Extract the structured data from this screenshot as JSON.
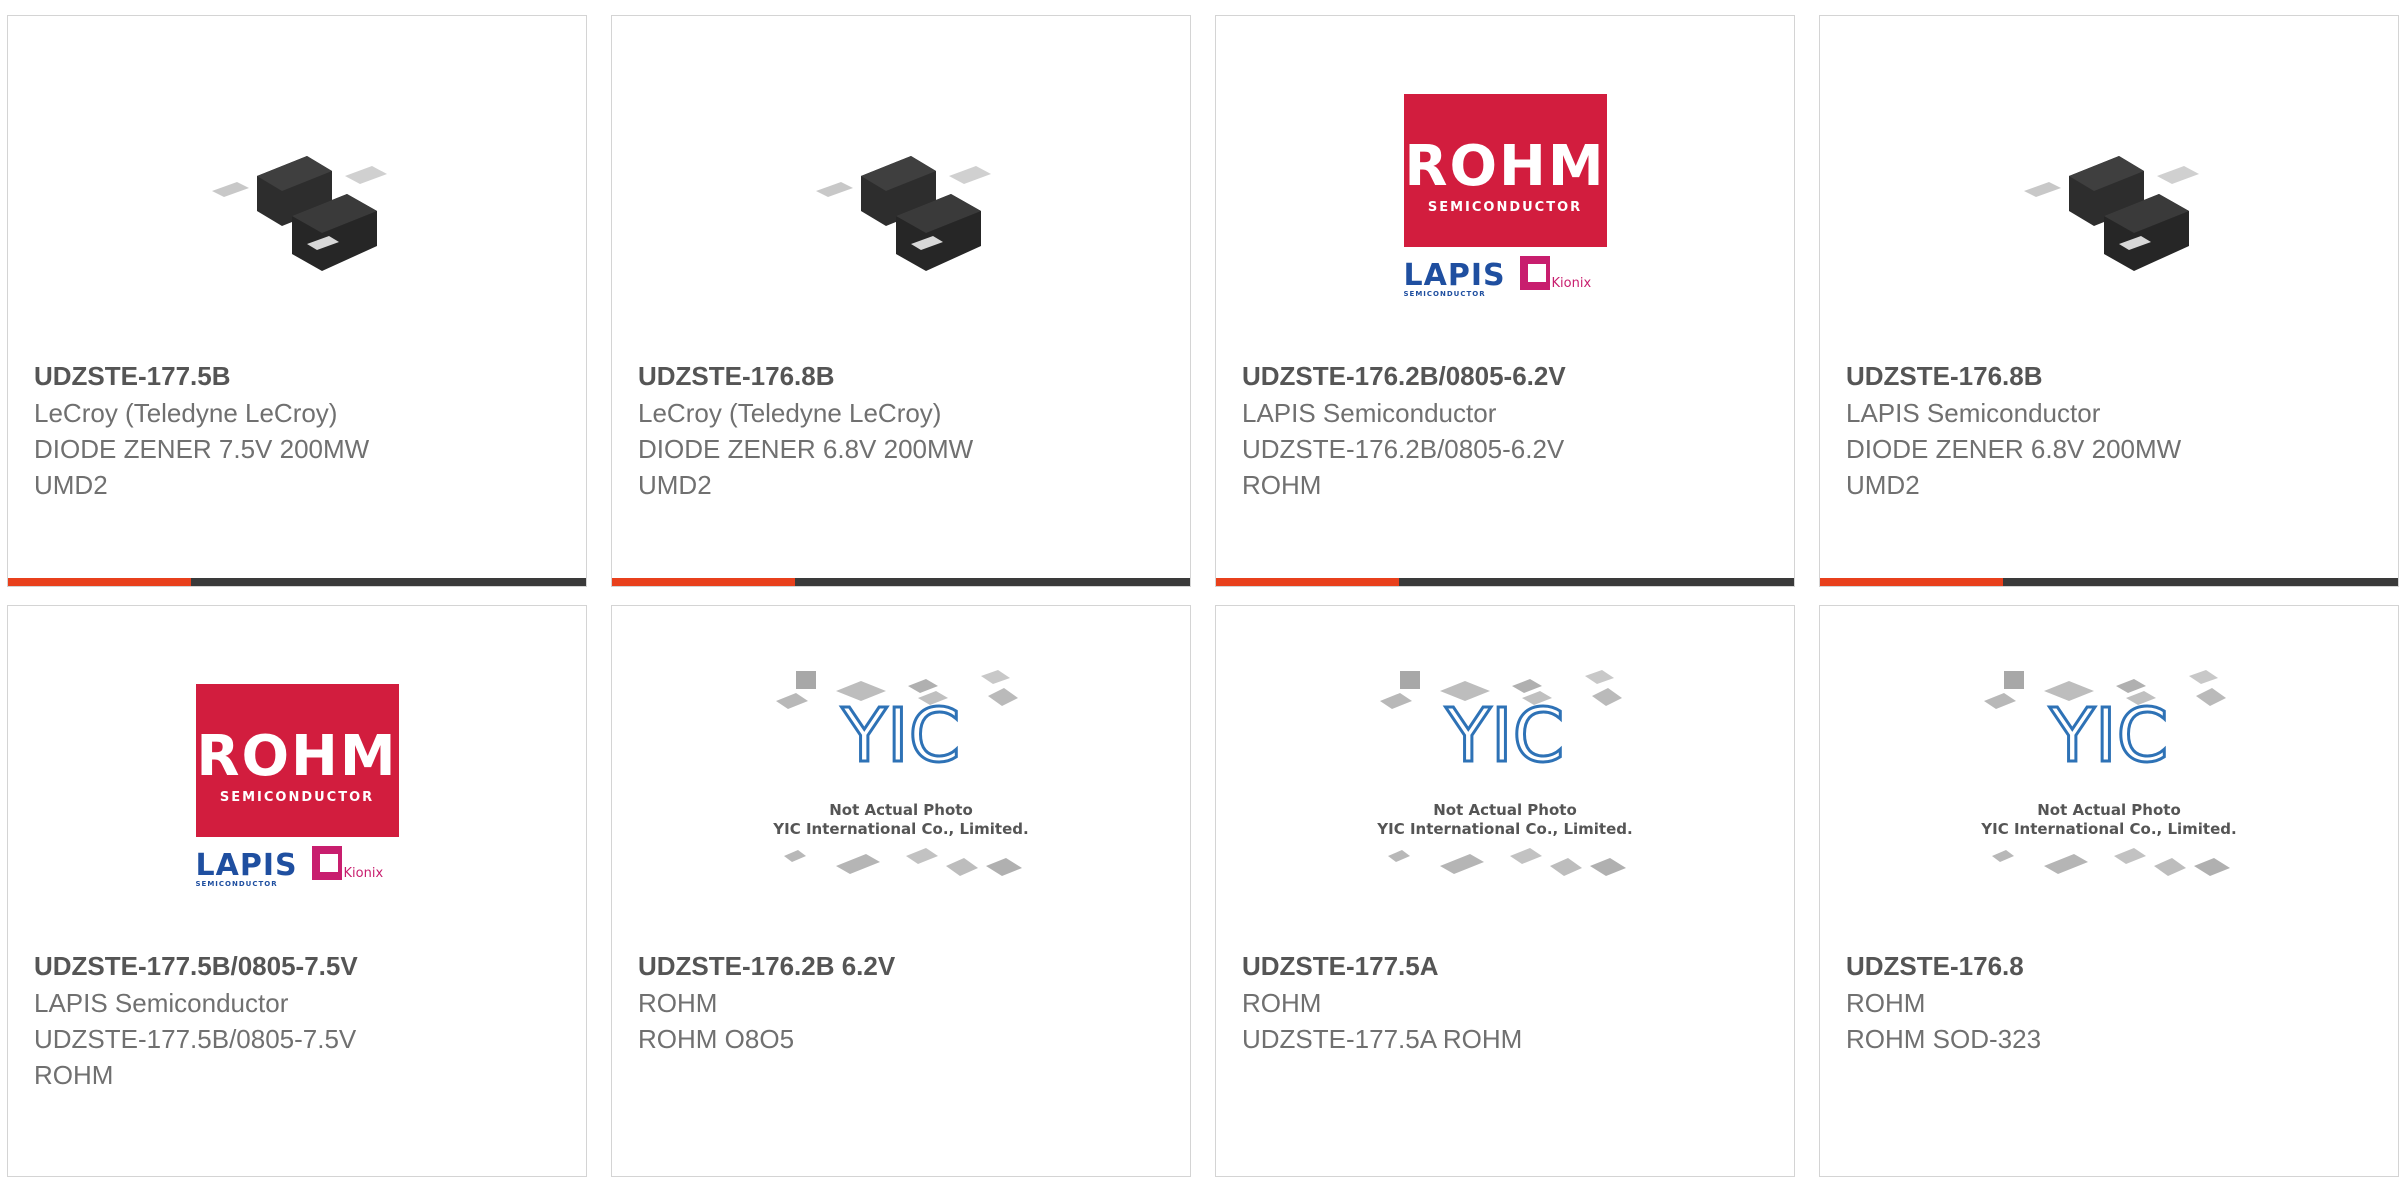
{
  "cards": [
    {
      "title": "UDZSTE-177.5B",
      "maker": "LeCroy (Teledyne LeCroy)",
      "desc": "DIODE ZENER 7.5V 200MW",
      "pkg": "UMD2",
      "image": "diode-package-photo"
    },
    {
      "title": "UDZSTE-176.8B",
      "maker": "LeCroy (Teledyne LeCroy)",
      "desc": "DIODE ZENER 6.8V 200MW",
      "pkg": "UMD2",
      "image": "diode-package-photo"
    },
    {
      "title": "UDZSTE-176.2B/0805-6.2V",
      "maker": "LAPIS Semiconductor",
      "desc": "UDZSTE-176.2B/0805-6.2V",
      "pkg": "ROHM",
      "image": "rohm-logo"
    },
    {
      "title": "UDZSTE-176.8B",
      "maker": "LAPIS Semiconductor",
      "desc": "DIODE ZENER 6.8V 200MW",
      "pkg": "UMD2",
      "image": "diode-package-photo"
    },
    {
      "title": "UDZSTE-177.5B/0805-7.5V",
      "maker": "LAPIS Semiconductor",
      "desc": "UDZSTE-177.5B/0805-7.5V",
      "pkg": "ROHM",
      "image": "rohm-logo"
    },
    {
      "title": "UDZSTE-176.2B 6.2V",
      "maker": "ROHM",
      "desc": "ROHM O8O5",
      "pkg": "",
      "image": "yic-placeholder"
    },
    {
      "title": "UDZSTE-177.5A",
      "maker": "ROHM",
      "desc": "UDZSTE-177.5A ROHM",
      "pkg": "",
      "image": "yic-placeholder"
    },
    {
      "title": "UDZSTE-176.8",
      "maker": "ROHM",
      "desc": "ROHM SOD-323",
      "pkg": "",
      "image": "yic-placeholder"
    }
  ],
  "rohm_logo": {
    "brand": "ROHM",
    "sub": "SEMICONDUCTOR",
    "lapis": "LAPIS",
    "lapis_sub": "SEMICONDUCTOR",
    "kionix": "Kionix"
  },
  "yic_placeholder": {
    "mark": "YIC",
    "line1": "Not Actual Photo",
    "line2": "YIC International Co., Limited."
  },
  "colors": {
    "accent": "#e8401c",
    "bar": "#3a3a3a",
    "rohm_red": "#d21d3e",
    "lapis_blue": "#1f4fa0",
    "kionix_pink": "#c81e6e"
  }
}
